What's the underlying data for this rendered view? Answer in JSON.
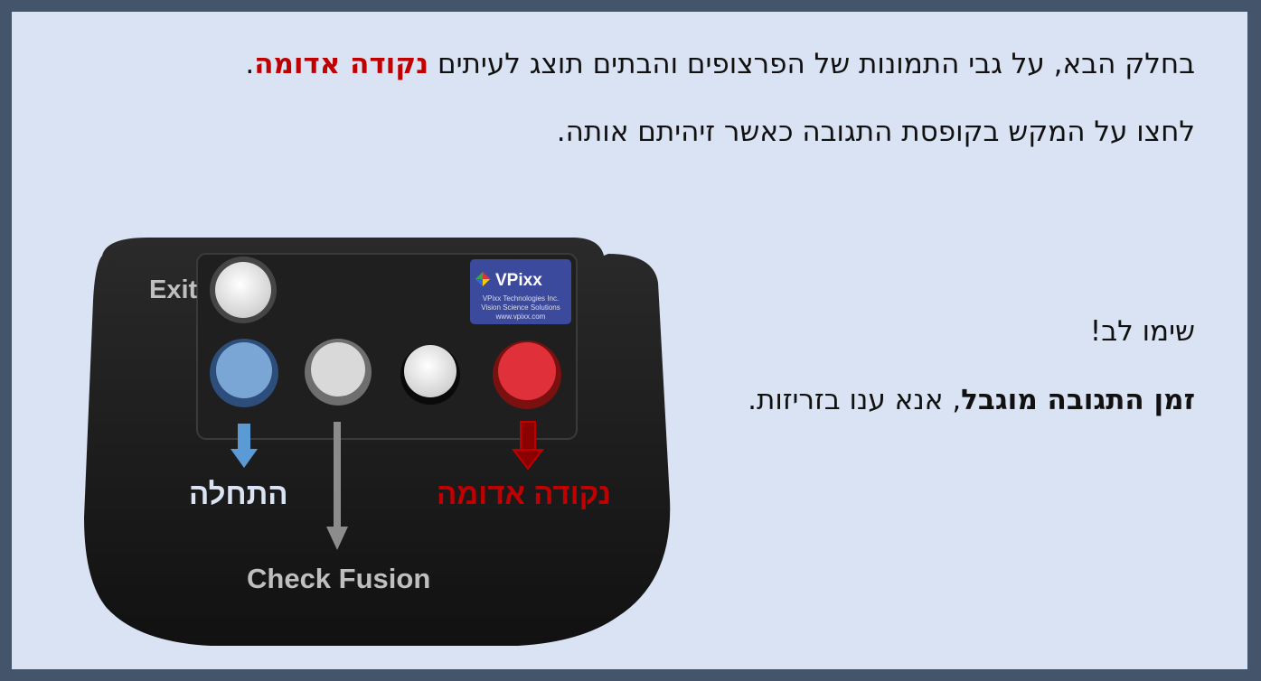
{
  "instructions": {
    "line1_pre": "בחלק הבא, על גבי התמונות של הפרצופים והבתים תוצג לעיתים ",
    "line1_red": "נקודה אדומה",
    "line1_post": ".",
    "line2": "לחצו על המקש בקופסת התגובה כאשר זיהיתם אותה.",
    "attention": "שימו לב!",
    "line4_bold": "זמן התגובה מוגבל",
    "line4_rest": ", אנא ענו בזריזות."
  },
  "device": {
    "brand": "VPixx",
    "brand_line1": "VPixx Technologies Inc.",
    "brand_line2": "Vision Science Solutions",
    "brand_line3": "www.vpixx.com",
    "labels": {
      "exit": "Exit",
      "start": "התחלה",
      "check_fusion": "Check Fusion",
      "red_dot": "נקודה אדומה"
    },
    "button_colors": {
      "exit": "#f2f2f2",
      "blue": "#7aa6d6",
      "gray": "#d9d9d9",
      "white": "#f5f5f5",
      "red": "#e0303a"
    }
  }
}
